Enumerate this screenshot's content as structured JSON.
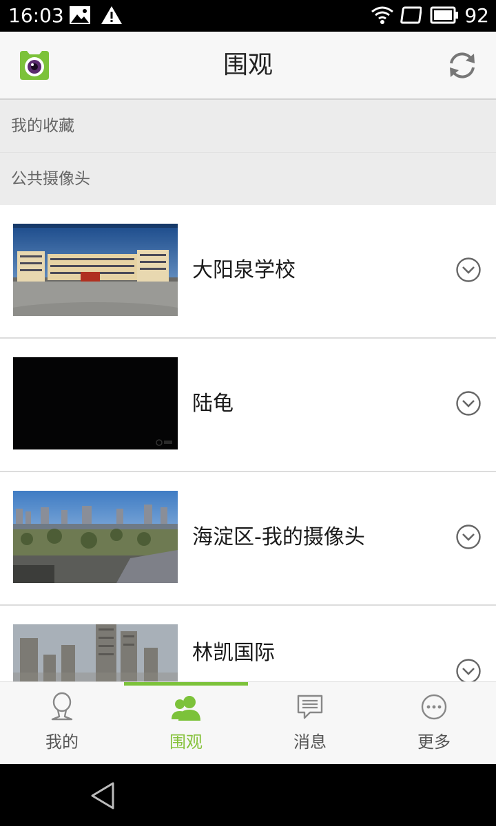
{
  "status_bar": {
    "time": "16:03",
    "battery_percent": "92",
    "icons": [
      "image-icon",
      "warning-icon",
      "wifi-icon",
      "screen-icon",
      "battery-icon"
    ]
  },
  "header": {
    "title": "围观",
    "left_icon": "app-logo-icon",
    "right_icon": "refresh-icon"
  },
  "sections": {
    "favorites": "我的收藏",
    "public_cameras": "公共摄像头"
  },
  "cameras": [
    {
      "name": "大阳泉学校",
      "thumb": "school"
    },
    {
      "name": "陆龟",
      "thumb": "dark"
    },
    {
      "name": "海淀区-我的摄像头",
      "thumb": "city"
    },
    {
      "name": "林凯国际",
      "thumb": "towers"
    }
  ],
  "bottom_nav": [
    {
      "label": "我的",
      "icon": "user-icon",
      "active": false
    },
    {
      "label": "围观",
      "icon": "group-icon",
      "active": true
    },
    {
      "label": "消息",
      "icon": "message-icon",
      "active": false
    },
    {
      "label": "更多",
      "icon": "more-icon",
      "active": false
    }
  ],
  "colors": {
    "accent": "#7cc23a",
    "header_bg": "#f7f7f7",
    "section_bg": "#ececec"
  }
}
